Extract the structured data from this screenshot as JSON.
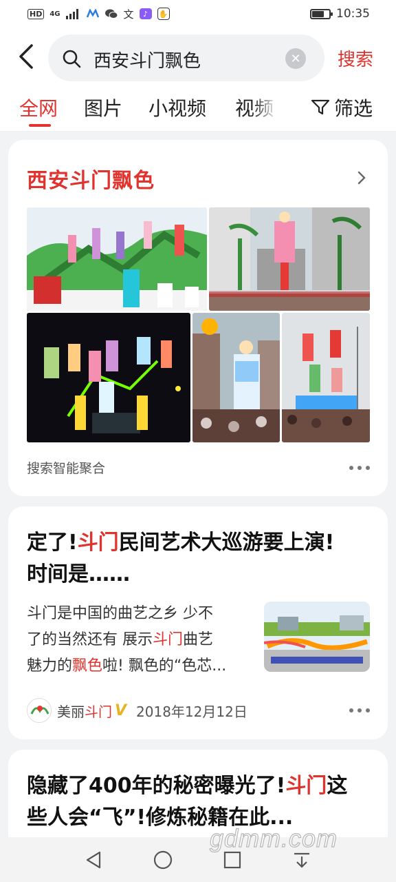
{
  "status_bar": {
    "hd": "HD",
    "network": "4G",
    "translate_icon_char": "文",
    "time": "10:35",
    "battery_level": 0.7
  },
  "header": {
    "search_query": "西安斗门飘色",
    "search_button": "搜索"
  },
  "tabs": [
    {
      "label": "全网",
      "active": true
    },
    {
      "label": "图片",
      "active": false
    },
    {
      "label": "小视频",
      "active": false
    },
    {
      "label": "视频",
      "active": false
    }
  ],
  "filter_label": "筛选",
  "aggregate_card": {
    "title": "西安斗门飘色",
    "footer": "搜索智能聚合"
  },
  "article1": {
    "title_parts": [
      "定了!",
      "斗门",
      "民间艺术大巡游要上演!"
    ],
    "title_line2": "时间是……",
    "snippet_line1": "斗门是中国的曲艺之乡 少不",
    "snippet_line2_parts": [
      "了的当然还有 展示",
      "斗门",
      "曲艺"
    ],
    "snippet_line3_parts": [
      "魅力的",
      "飘色",
      "啦! 飘色的“色芯..."
    ],
    "source_parts": [
      "美丽",
      "斗门"
    ],
    "verified_mark": "V",
    "date": "2018年12月12日"
  },
  "article2": {
    "title_line1_parts": [
      "隐藏了400年的秘密曝光了!",
      "斗门",
      "这"
    ],
    "title_line2": "些人会“飞”!修炼秘籍在此..."
  },
  "watermark": "gdmm.com",
  "colors": {
    "accent": "#e0332e",
    "page_bg": "#f2f3f5",
    "verified": "#e6b422"
  }
}
